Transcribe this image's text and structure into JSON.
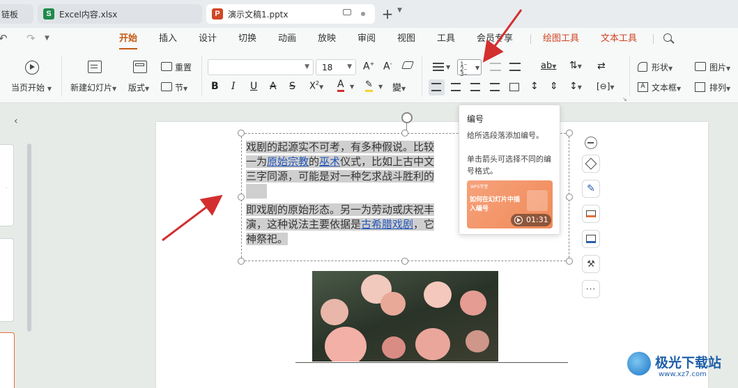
{
  "tabs": {
    "t0": "链板",
    "t1": "Excel内容.xlsx",
    "t2": "演示文稿1.pptx",
    "t1_icon": "S",
    "t2_icon": "P",
    "new_tab": "+"
  },
  "menu": {
    "items": [
      "开始",
      "插入",
      "设计",
      "切换",
      "动画",
      "放映",
      "审阅",
      "视图",
      "工具",
      "会员专享",
      "绘图工具",
      "文本工具"
    ]
  },
  "ribbon": {
    "play_from_current": "当页开始",
    "new_slide": "新建幻灯片",
    "layout": "版式",
    "reset": "重置",
    "section": "节",
    "font_size": "18",
    "shape": "形状",
    "picture": "图片",
    "textbox": "文本框",
    "arrange": "排列"
  },
  "slide_text": {
    "l1": "戏剧的起源实不可考，有多种假说。比较",
    "l2a": "一为",
    "l2b": "原始宗教",
    "l2c": "的",
    "l2d": "巫术",
    "l2e": "仪式，比如上古中文",
    "l3": "三字同源，可能是对一种乞求战斗胜利的",
    "l4": "即戏剧的原始形态。另一为劳动或庆祝丰",
    "l5a": "演，这种说法主要依据是",
    "l5b": "古希腊戏剧",
    "l5c": "，它",
    "l6": "神祭祀。"
  },
  "tooltip": {
    "title": "编号",
    "desc1": "给所选段落添加编号。",
    "desc2": "单击箭头可选择不同的编号格式。",
    "video_brand": "WPS学堂",
    "video_title": "如何在幻灯片中插入编号",
    "video_time": "01:31"
  },
  "watermark": {
    "name": "极光下载站",
    "url": "www.xz7.com"
  },
  "colors": {
    "accent": "#c55a11",
    "draw_tools": "#d14424",
    "annotation_arrow": "#d32f2f"
  }
}
